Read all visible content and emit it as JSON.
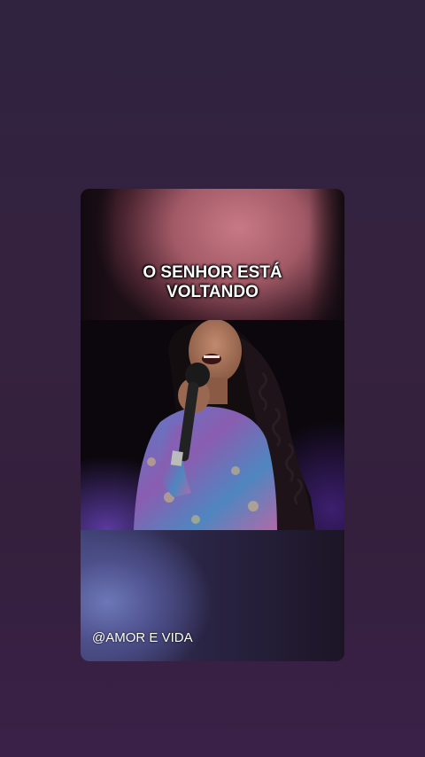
{
  "post": {
    "caption_line1": "O SENHOR ESTÁ",
    "caption_line2": "VOLTANDO",
    "handle": "@AMOR E VIDA"
  },
  "video": {
    "description_icon": "singer-video-frame"
  },
  "colors": {
    "background": "#34203d",
    "caption_text": "#ffffff"
  }
}
